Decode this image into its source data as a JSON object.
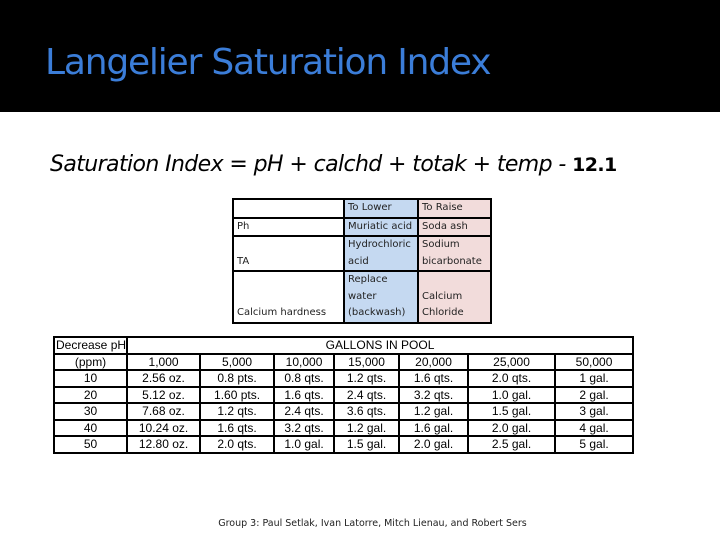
{
  "slide": {
    "title": "Langelier Saturation Index",
    "formula_text": "Saturation Index = pH + calchd + totak + temp - ",
    "formula_constant": "12.1",
    "footer": "Group 3: Paul Setlak, Ivan Latorre, Mitch Lienau, and Robert Sers"
  },
  "colors": {
    "title": "#3B7DD8",
    "banner": "#000000",
    "to_lower_column": "#C5D9F1",
    "to_raise_column": "#F2DCDB"
  },
  "treatment_table": {
    "header": {
      "parameter": "",
      "to_lower": "To Lower",
      "to_raise": "To Raise"
    },
    "rows": [
      {
        "parameter": "Ph",
        "to_lower": [
          "Muriatic acid"
        ],
        "to_raise": [
          "Soda ash"
        ]
      },
      {
        "parameter": "TA",
        "to_lower": [
          "Hydrochloric",
          "acid"
        ],
        "to_raise": [
          "Sodium",
          "bicarbonate"
        ]
      },
      {
        "parameter": "Calcium hardness",
        "to_lower": [
          "Replace",
          "water",
          "(backwash)"
        ],
        "to_raise": [
          "Calcium",
          "Chloride"
        ]
      }
    ]
  },
  "gallons_table": {
    "corner_label": "Decrease pH",
    "group_header": "GALLONS IN POOL",
    "unit_label": "(ppm)",
    "columns": [
      "1,000",
      "5,000",
      "10,000",
      "15,000",
      "20,000",
      "25,000",
      "50,000"
    ],
    "rows": [
      {
        "ppm": "10",
        "values": [
          "2.56 oz.",
          "0.8 pts.",
          "0.8 qts.",
          "1.2 qts.",
          "1.6 qts.",
          "2.0 qts.",
          "1 gal."
        ]
      },
      {
        "ppm": "20",
        "values": [
          "5.12 oz.",
          "1.60 pts.",
          "1.6 qts.",
          "2.4 qts.",
          "3.2 qts.",
          "1.0 gal.",
          "2 gal."
        ]
      },
      {
        "ppm": "30",
        "values": [
          "7.68 oz.",
          "1.2 qts.",
          "2.4 qts.",
          "3.6 qts.",
          "1.2 gal.",
          "1.5 gal.",
          "3 gal."
        ]
      },
      {
        "ppm": "40",
        "values": [
          "10.24 oz.",
          "1.6 qts.",
          "3.2 qts.",
          "1.2 gal.",
          "1.6 gal.",
          "2.0 gal.",
          "4 gal."
        ]
      },
      {
        "ppm": "50",
        "values": [
          "12.80 oz.",
          "2.0 qts.",
          "1.0 gal.",
          "1.5 gal.",
          "2.0 gal.",
          "2.5 gal.",
          "5 gal."
        ]
      }
    ]
  }
}
